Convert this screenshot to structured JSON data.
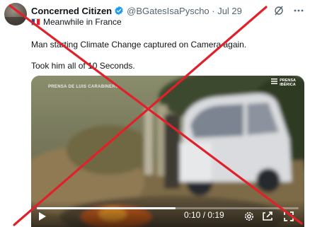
{
  "tweet": {
    "author_name": "Concerned Citizen",
    "handle_date": "@BGatesIsaPyscho · Jul 29",
    "location_line": "Meanwhile in France",
    "text_line1": "Man starting Climate Change captured on Camera again.",
    "text_line2": "Took him all of 10 Seconds."
  },
  "video": {
    "watermark_left": "PRENSA DE LUIS CARABINERO",
    "watermark_right_line1": "PRENSA",
    "watermark_right_line2": "IBÉRICA",
    "time_display": "0:10 / 0:19",
    "progress_fraction": 0.53
  },
  "colors": {
    "verified": "#1d9bf0",
    "overlay_x": "#e0212a",
    "muted_text": "#536471"
  },
  "icons": [
    "verified-badge-icon",
    "grok-icon",
    "more-dots-icon",
    "flag-france-icon",
    "play-icon",
    "settings-icon",
    "captions-icon",
    "fullscreen-icon",
    "red-x-overlay"
  ]
}
